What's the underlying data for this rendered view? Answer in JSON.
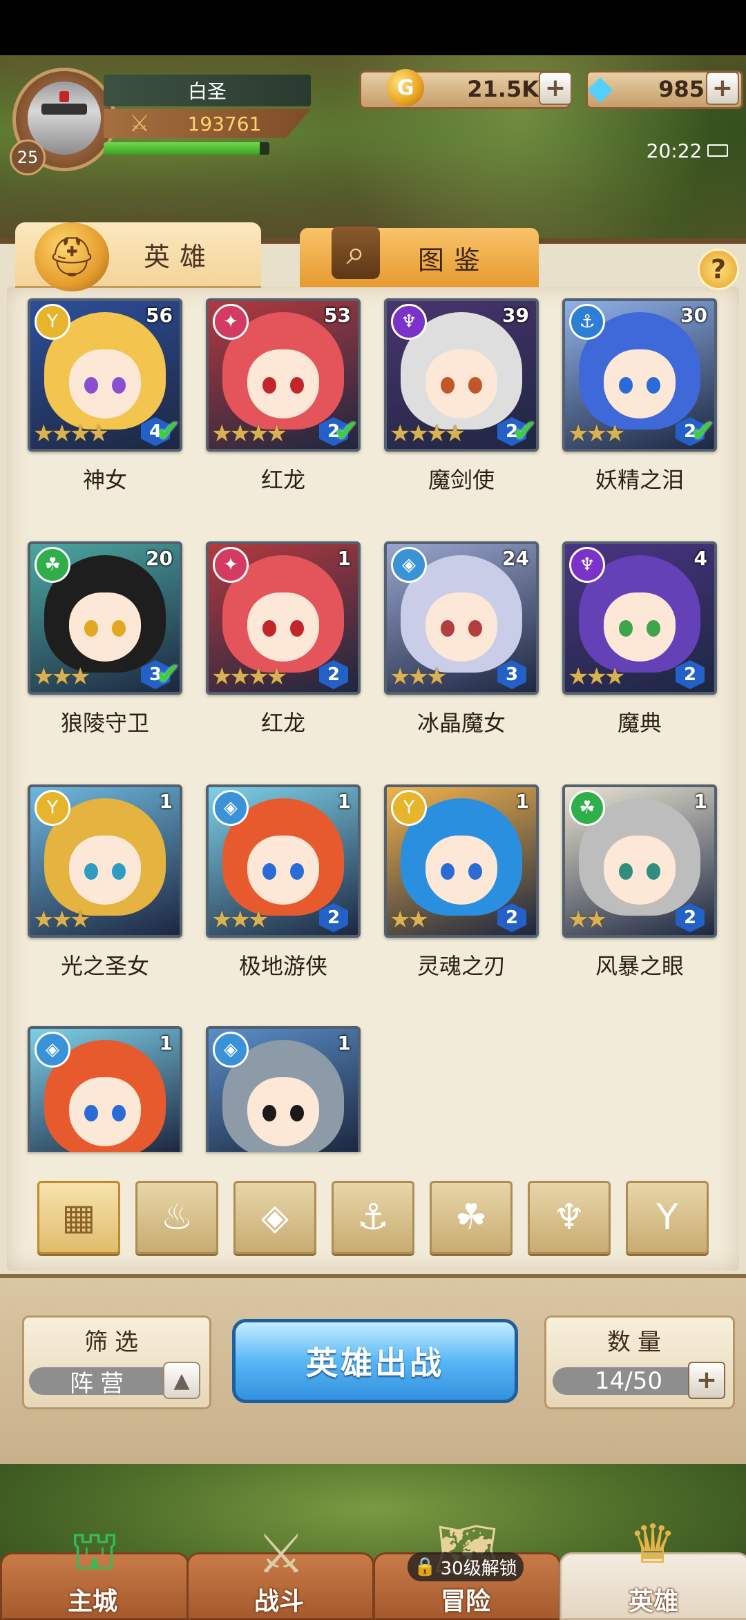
{
  "player": {
    "name": "白圣",
    "level": "25",
    "power": "193761",
    "xp_fraction": 0.94
  },
  "currency": {
    "gold": "21.5K",
    "gems": "985"
  },
  "status": {
    "time": "20:22"
  },
  "tabs": [
    {
      "label": "英雄"
    },
    {
      "label": "图鉴"
    }
  ],
  "heroes": [
    {
      "name": "神女",
      "count": "56",
      "stars": 4,
      "tier": "4",
      "deployed": true,
      "faction": "light",
      "hair": "#f3c54e",
      "bg": "#2d4f9a",
      "eye": "#8a4fd0"
    },
    {
      "name": "红龙",
      "count": "53",
      "stars": 4,
      "tier": "2",
      "deployed": true,
      "faction": "fire",
      "hair": "#e4545b",
      "bg": "#b23a3f",
      "eye": "#c3262a"
    },
    {
      "name": "魔剑使",
      "count": "39",
      "stars": 4,
      "tier": "2",
      "deployed": true,
      "faction": "dark",
      "hair": "#dedede",
      "bg": "#4b3470",
      "eye": "#c0562a"
    },
    {
      "name": "妖精之泪",
      "count": "30",
      "stars": 3,
      "tier": "2",
      "deployed": true,
      "faction": "water",
      "hair": "#3f68d8",
      "bg": "#8fb1e8",
      "eye": "#2a6cd6"
    },
    {
      "name": "狼陵守卫",
      "count": "20",
      "stars": 3,
      "tier": "3",
      "deployed": true,
      "faction": "nature",
      "hair": "#1e1e1e",
      "bg": "#4ba7a0",
      "eye": "#e2a81f"
    },
    {
      "name": "红龙",
      "count": "1",
      "stars": 4,
      "tier": "2",
      "deployed": false,
      "faction": "fire",
      "hair": "#e4545b",
      "bg": "#b23a3f",
      "eye": "#c3262a"
    },
    {
      "name": "冰晶魔女",
      "count": "24",
      "stars": 3,
      "tier": "3",
      "deployed": false,
      "faction": "ice",
      "hair": "#c9cde8",
      "bg": "#9aa5cf",
      "eye": "#b33e3e"
    },
    {
      "name": "魔典",
      "count": "4",
      "stars": 3,
      "tier": "2",
      "deployed": false,
      "faction": "dark",
      "hair": "#6541b8",
      "bg": "#4a3484",
      "eye": "#3fa54b"
    },
    {
      "name": "光之圣女",
      "count": "1",
      "stars": 3,
      "tier": "",
      "deployed": false,
      "faction": "light",
      "hair": "#e5b340",
      "bg": "#6fb8de",
      "eye": "#2f9bc5"
    },
    {
      "name": "极地游侠",
      "count": "1",
      "stars": 3,
      "tier": "2",
      "deployed": false,
      "faction": "ice",
      "hair": "#e65a2e",
      "bg": "#7dd0e8",
      "eye": "#2a6cd6"
    },
    {
      "name": "灵魂之刃",
      "count": "1",
      "stars": 2,
      "tier": "2",
      "deployed": false,
      "faction": "light",
      "hair": "#2b8fe0",
      "bg": "#f0b24c",
      "eye": "#2a6cd6"
    },
    {
      "name": "风暴之眼",
      "count": "1",
      "stars": 2,
      "tier": "2",
      "deployed": false,
      "faction": "nature",
      "hair": "#bdbdbd",
      "bg": "#e9e4d2",
      "eye": "#2f8e7d"
    },
    {
      "name": "",
      "count": "1",
      "stars": 0,
      "tier": "",
      "deployed": false,
      "faction": "ice",
      "hair": "#e65a2e",
      "bg": "#7dd0e8",
      "eye": "#2a6cd6"
    },
    {
      "name": "",
      "count": "1",
      "stars": 0,
      "tier": "",
      "deployed": false,
      "faction": "ice",
      "hair": "#8d9aa8",
      "bg": "#5a8fc8",
      "eye": "#1a1a1a"
    }
  ],
  "faction_colors": {
    "light": "#e7b52c",
    "fire": "#d33b62",
    "dark": "#7a32c9",
    "water": "#2d7fd6",
    "nature": "#2fae4a",
    "ice": "#3a93d8"
  },
  "faction_icons": {
    "light": "Y",
    "fire": "✦",
    "dark": "♆",
    "water": "⚓",
    "nature": "☘",
    "ice": "◈"
  },
  "filters": [
    "all",
    "fire",
    "ice",
    "water",
    "nature",
    "dark",
    "light"
  ],
  "filter_icons": [
    "▦",
    "♨",
    "◈",
    "⚓",
    "☘",
    "♆",
    "Y"
  ],
  "controls": {
    "filter_label": "筛选",
    "filter_value": "阵营",
    "deploy": "英雄出战",
    "qty_label": "数量",
    "qty_value": "14/50"
  },
  "nav": [
    {
      "label": "主城",
      "icon": "castle-icon"
    },
    {
      "label": "战斗",
      "icon": "crossed-swords-icon"
    },
    {
      "label": "冒险",
      "icon": "map-icon",
      "lock_text": "30级解锁"
    },
    {
      "label": "英雄",
      "icon": "hero-crest-icon"
    }
  ]
}
